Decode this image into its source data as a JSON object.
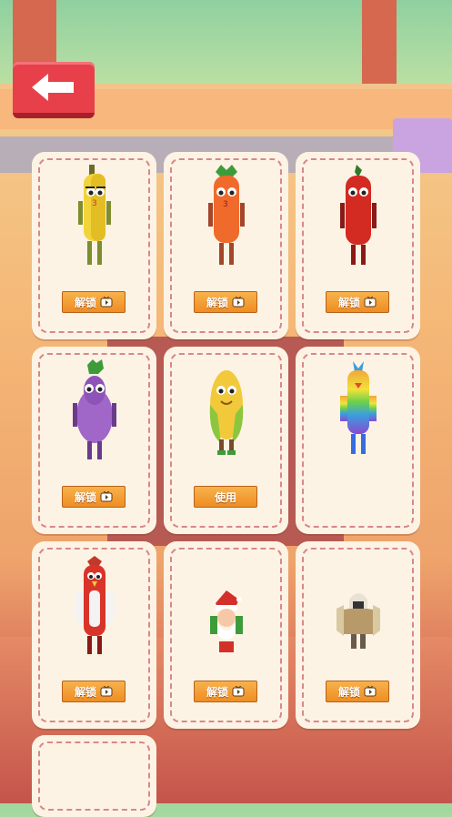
{
  "nav": {
    "back_icon": "left-arrow-icon"
  },
  "colors": {
    "button": "#f29a2e",
    "back_button": "#e8404b",
    "card": "#fdf3e4",
    "dash": "#d7888a"
  },
  "cards": [
    {
      "character": "banana",
      "button_label": "解锁",
      "button_icon": "video-ad-icon"
    },
    {
      "character": "carrot",
      "button_label": "解锁",
      "button_icon": "video-ad-icon"
    },
    {
      "character": "chili-pepper",
      "button_label": "解锁",
      "button_icon": "video-ad-icon"
    },
    {
      "character": "eggplant",
      "button_label": "解锁",
      "button_icon": "video-ad-icon"
    },
    {
      "character": "corn",
      "button_label": "使用",
      "button_icon": ""
    },
    {
      "character": "rainbow-bird",
      "button_label": "",
      "button_icon": ""
    },
    {
      "character": "red-bird",
      "button_label": "解锁",
      "button_icon": "video-ad-icon"
    },
    {
      "character": "santa",
      "button_label": "解锁",
      "button_icon": "video-ad-icon"
    },
    {
      "character": "armored-knight",
      "button_label": "解锁",
      "button_icon": "video-ad-icon"
    },
    {
      "character": "empty",
      "button_label": "",
      "button_icon": ""
    }
  ]
}
